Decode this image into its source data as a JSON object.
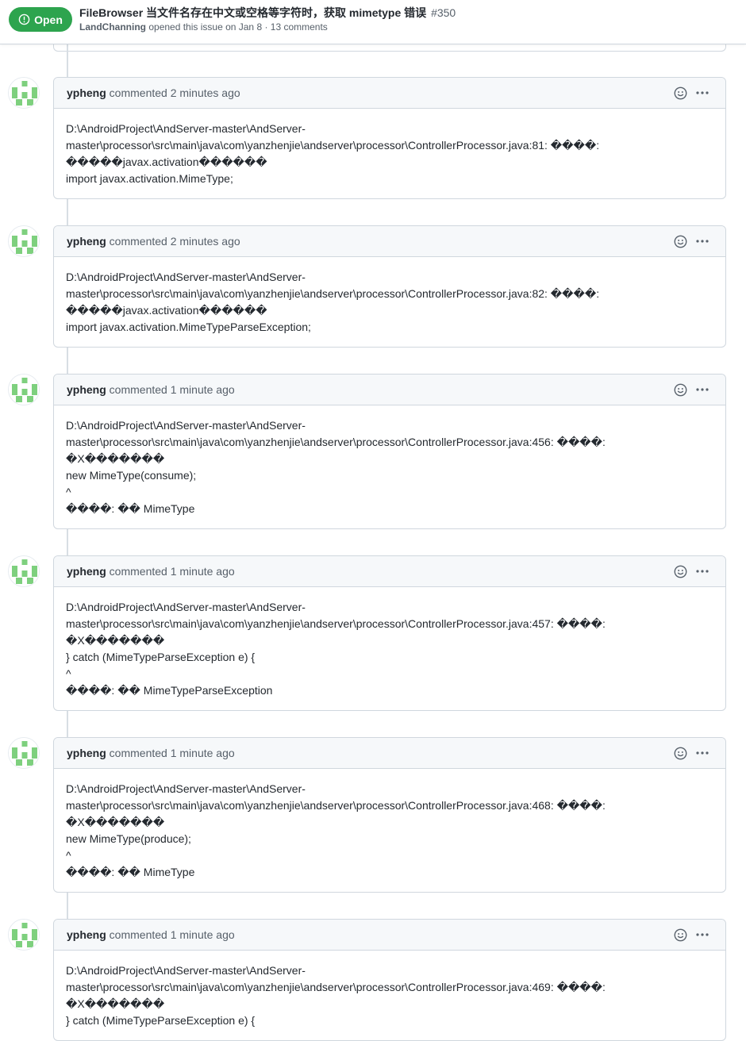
{
  "issue": {
    "state": "Open",
    "title": "FileBrowser 当文件名存在中文或空格等字符时，获取 mimetype 错误",
    "number": "#350",
    "author": "LandChanning",
    "meta": "opened this issue on Jan 8 · 13 comments"
  },
  "comments": [
    {
      "author": "ypheng",
      "action": "commented 2 minutes ago",
      "lines": [
        "D:\\AndroidProject\\AndServer-master\\AndServer-",
        "master\\processor\\src\\main\\java\\com\\yanzhenjie\\andserver\\processor\\ControllerProcessor.java:81: ����:",
        "�����javax.activation������",
        "import javax.activation.MimeType;"
      ]
    },
    {
      "author": "ypheng",
      "action": "commented 2 minutes ago",
      "lines": [
        "D:\\AndroidProject\\AndServer-master\\AndServer-",
        "master\\processor\\src\\main\\java\\com\\yanzhenjie\\andserver\\processor\\ControllerProcessor.java:82: ����:",
        "�����javax.activation������",
        "import javax.activation.MimeTypeParseException;"
      ]
    },
    {
      "author": "ypheng",
      "action": "commented 1 minute ago",
      "lines": [
        "D:\\AndroidProject\\AndServer-master\\AndServer-",
        "master\\processor\\src\\main\\java\\com\\yanzhenjie\\andserver\\processor\\ControllerProcessor.java:456: ����:",
        "�X�������",
        "new MimeType(consume);",
        "^",
        "����: �� MimeType"
      ]
    },
    {
      "author": "ypheng",
      "action": "commented 1 minute ago",
      "lines": [
        "D:\\AndroidProject\\AndServer-master\\AndServer-",
        "master\\processor\\src\\main\\java\\com\\yanzhenjie\\andserver\\processor\\ControllerProcessor.java:457: ����:",
        "�X�������",
        "} catch (MimeTypeParseException e) {",
        "^",
        "����: �� MimeTypeParseException"
      ]
    },
    {
      "author": "ypheng",
      "action": "commented 1 minute ago",
      "lines": [
        "D:\\AndroidProject\\AndServer-master\\AndServer-",
        "master\\processor\\src\\main\\java\\com\\yanzhenjie\\andserver\\processor\\ControllerProcessor.java:468: ����:",
        "�X�������",
        "new MimeType(produce);",
        "^",
        "����: �� MimeType"
      ]
    },
    {
      "author": "ypheng",
      "action": "commented 1 minute ago",
      "lines": [
        "D:\\AndroidProject\\AndServer-master\\AndServer-",
        "master\\processor\\src\\main\\java\\com\\yanzhenjie\\andserver\\processor\\ControllerProcessor.java:469: ����:",
        "�X�������",
        "} catch (MimeTypeParseException e) {"
      ]
    }
  ],
  "colors": {
    "open_badge": "#2da44e",
    "avatar_green": "#7ed07e",
    "header_bg": "#f6f8fa",
    "border": "#d0d7de"
  },
  "icons": [
    "issue-opened-icon",
    "smiley-icon",
    "kebab-horizontal-icon",
    "identicon-avatar"
  ]
}
